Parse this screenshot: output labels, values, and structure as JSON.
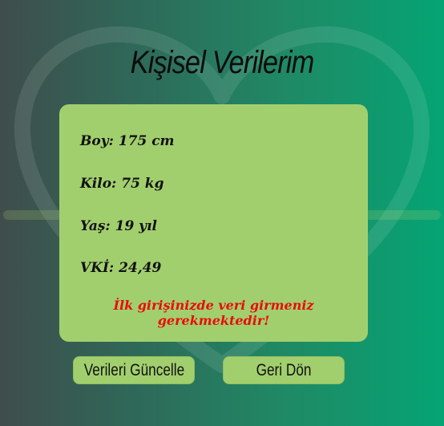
{
  "page": {
    "title": "Kişisel Verilerim"
  },
  "profile": {
    "height": {
      "label": "Boy",
      "value": "175 cm"
    },
    "weight": {
      "label": "Kilo",
      "value": "75 kg"
    },
    "age": {
      "label": "Yaş",
      "value": "19 yıl"
    },
    "bmi": {
      "label": "VKİ",
      "value": "24,49"
    }
  },
  "warning": "İlk girişinizde veri girmeniz gerekmektedir!",
  "buttons": {
    "update_label": "Verileri Güncelle",
    "back_label": "Geri Dön"
  },
  "colors": {
    "card": "#a2cf6e",
    "warning": "#e80d0d",
    "background_start": "#3f4d4b",
    "background_end": "#05a474"
  },
  "icons": {
    "background": "heart-heartbeat-icon"
  }
}
